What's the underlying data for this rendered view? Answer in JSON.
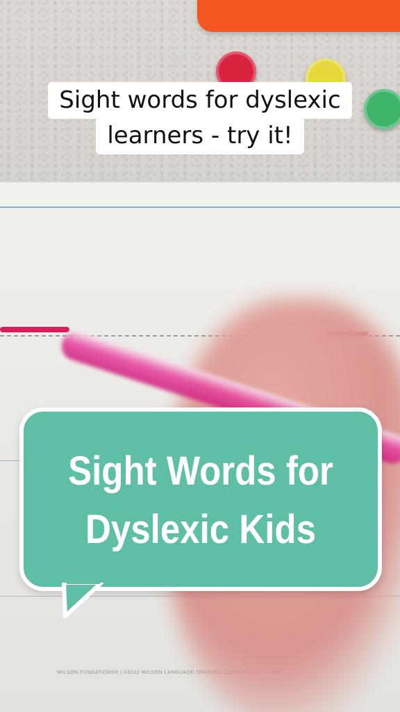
{
  "caption": {
    "line1": "Sight words for dyslexic",
    "line2": "learners - try it!"
  },
  "bubble": {
    "line1": "Sight Words for",
    "line2": "Dyslexic Kids",
    "color": "#5fbfa6"
  },
  "board_print": "WILSON FUNDATIONS® | ©2012 WILSON LANGUAGE TRAINING CORPORATION • ITEM"
}
